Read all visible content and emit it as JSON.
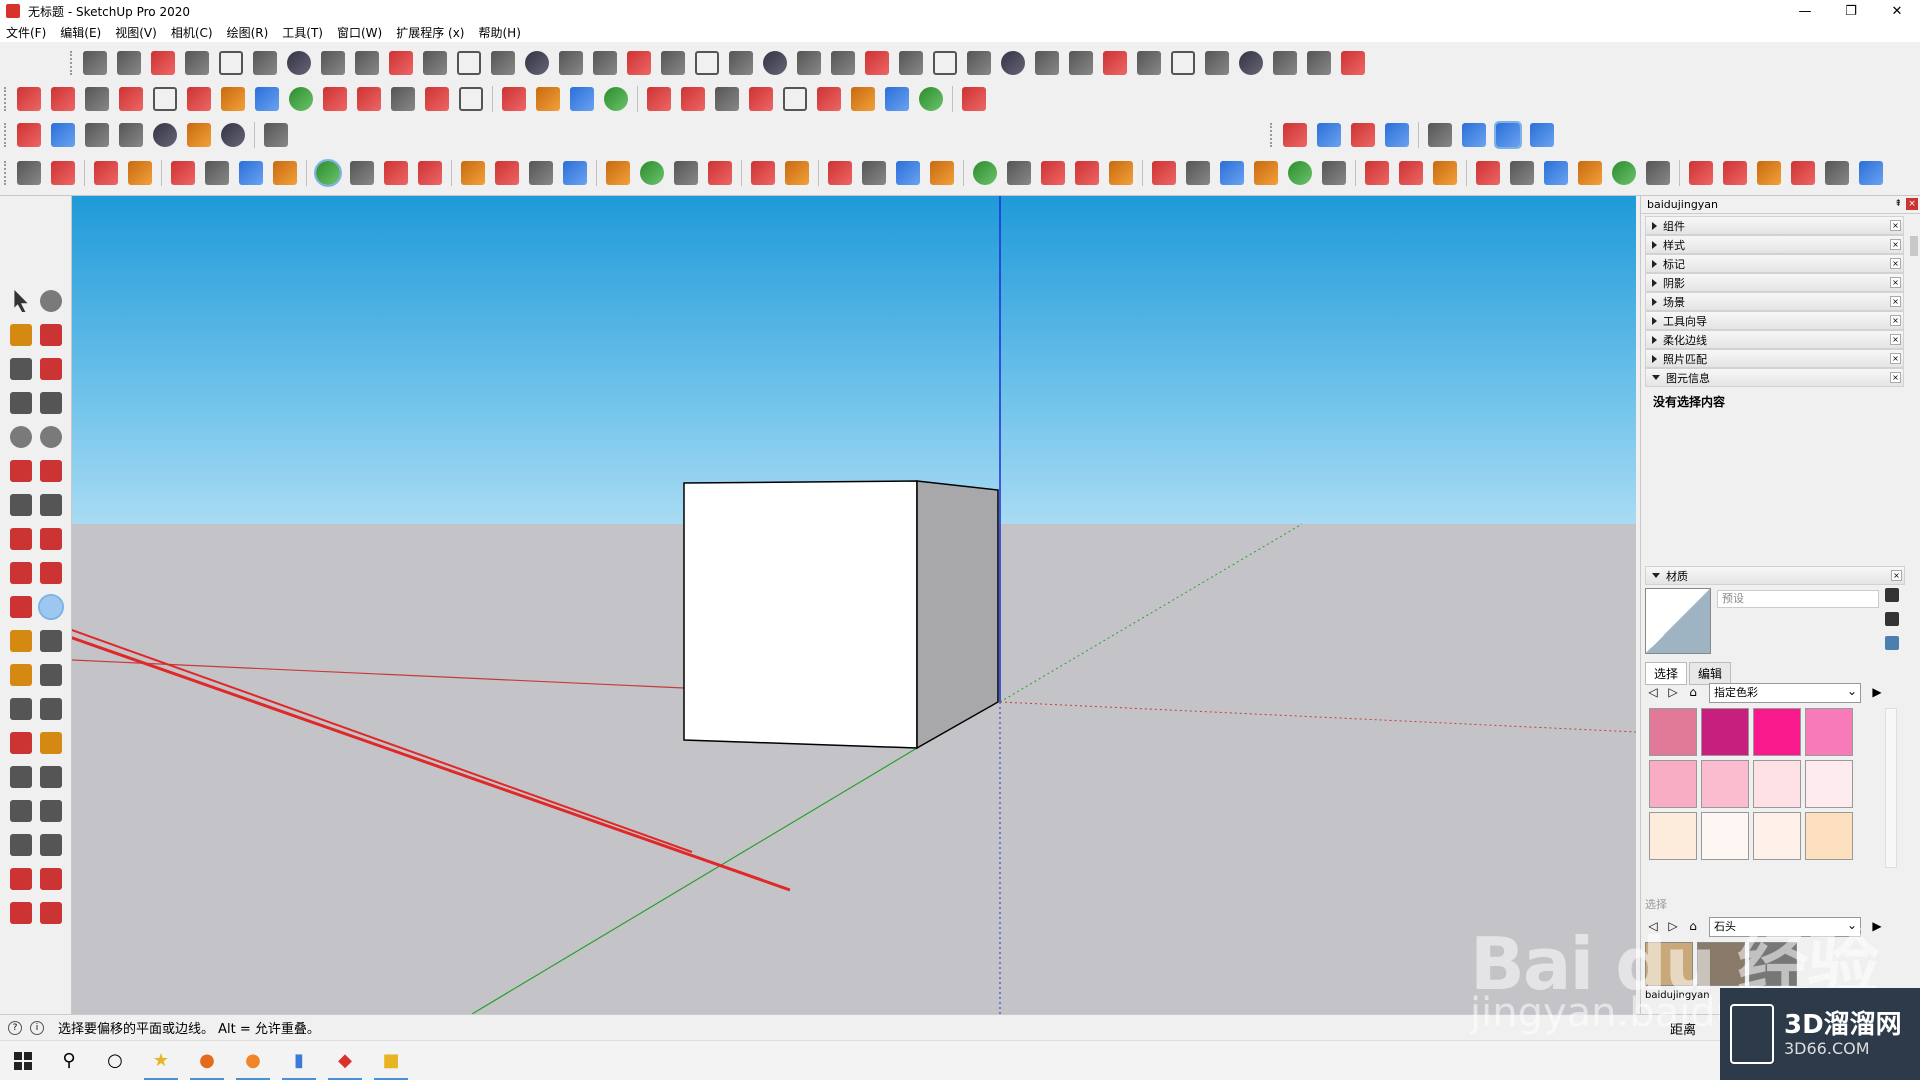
{
  "window": {
    "title": "无标题 - SketchUp Pro 2020",
    "minimize": "—",
    "restore": "❐",
    "close": "✕"
  },
  "menu": [
    "文件(F)",
    "编辑(E)",
    "视图(V)",
    "相机(C)",
    "绘图(R)",
    "工具(T)",
    "窗口(W)",
    "扩展程序 (x)",
    "帮助(H)"
  ],
  "tray": {
    "title": "baidujingyan",
    "pin": "⇞",
    "close": "×",
    "panels": [
      "组件",
      "样式",
      "标记",
      "阴影",
      "场景",
      "工具向导",
      "柔化边线",
      "照片匹配",
      "图元信息"
    ],
    "panel_close": "×",
    "entity_info_text": "没有选择内容",
    "materials": {
      "header": "材质",
      "name_placeholder": "预设",
      "tab_select": "选择",
      "tab_edit": "编辑",
      "collection": "指定色彩",
      "swatches": [
        "#e07a98",
        "#c71f7e",
        "#f81a8c",
        "#f77bb8",
        "#f9adc4",
        "#fbbcd0",
        "#fde1e4",
        "#fdebf0",
        "#fdebdc",
        "#fdf6f2",
        "#fdf1ea",
        "#fde0c0"
      ],
      "bottom_select_label": "选择",
      "bottom_collection": "石头",
      "bottom_label": "baidujingyan",
      "distance_label": "距离"
    }
  },
  "status": {
    "hint": "选择要偏移的平面或边线。 Alt = 允许重叠。",
    "icon1": "?",
    "icon2": "i"
  },
  "watermark": {
    "brand": "3D溜溜网",
    "site": "3D66.COM",
    "baidu": "Bai du 经验",
    "jingyan": "jingyan.baidu"
  },
  "colors": {
    "sky_top": "#1f9ad8",
    "ground": "#c4c4c8",
    "annotation_red": "#e02828",
    "axis_blue": "#1a2fd8",
    "axis_green": "#2aa02a",
    "axis_red": "#c83a3a"
  },
  "icons": {
    "taskbar": [
      "windows-logo-icon",
      "search-icon",
      "task-view-icon",
      "explorer-icon",
      "firefox-icon",
      "browser-icon",
      "tablet-icon",
      "sketchup-icon",
      "folder-icon"
    ]
  }
}
